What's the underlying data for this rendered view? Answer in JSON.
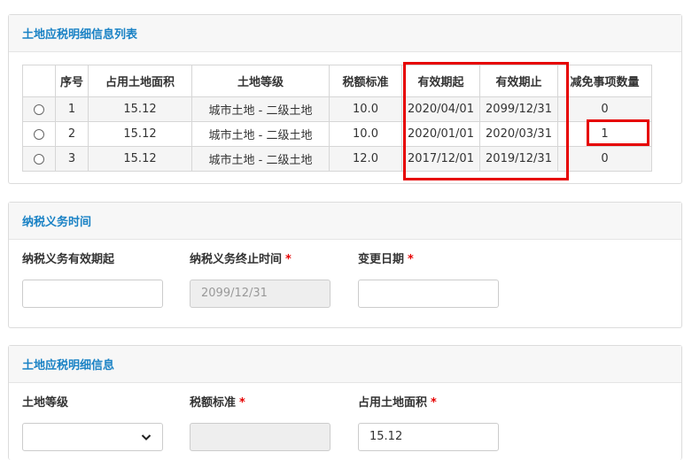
{
  "panel1": {
    "title": "土地应税明细信息列表",
    "columns": [
      "",
      "序号",
      "占用土地面积",
      "土地等级",
      "税额标准",
      "有效期起",
      "有效期止",
      "减免事项数量"
    ],
    "rows": [
      {
        "no": "1",
        "area": "15.12",
        "grade": "城市土地 - 二级土地",
        "rate": "10.0",
        "start": "2020/04/01",
        "end": "2099/12/31",
        "exempt": "0"
      },
      {
        "no": "2",
        "area": "15.12",
        "grade": "城市土地 - 二级土地",
        "rate": "10.0",
        "start": "2020/01/01",
        "end": "2020/03/31",
        "exempt": "1"
      },
      {
        "no": "3",
        "area": "15.12",
        "grade": "城市土地 - 二级土地",
        "rate": "12.0",
        "start": "2017/12/01",
        "end": "2019/12/31",
        "exempt": "0"
      }
    ],
    "highlight_color": "#e60000"
  },
  "panel2": {
    "title": "纳税义务时间",
    "fields": [
      {
        "label": "纳税义务有效期起",
        "required": false,
        "value": ""
      },
      {
        "label": "纳税义务终止时间",
        "required": true,
        "value": "2099/12/31",
        "disabled": true
      },
      {
        "label": "变更日期",
        "required": true,
        "value": ""
      }
    ]
  },
  "panel3": {
    "title": "土地应税明细信息",
    "fields": [
      {
        "label": "土地等级",
        "required": false,
        "value": "",
        "type": "select"
      },
      {
        "label": "税额标准",
        "required": true,
        "value": "",
        "disabled": true
      },
      {
        "label": "占用土地面积",
        "required": true,
        "value": "15.12"
      }
    ]
  },
  "required_mark": "*",
  "icons": {
    "row_select": "radio-icon",
    "dropdown": "chevron-down-icon"
  },
  "colors": {
    "title_blue": "#1a82c5",
    "required_red": "#e60000"
  }
}
